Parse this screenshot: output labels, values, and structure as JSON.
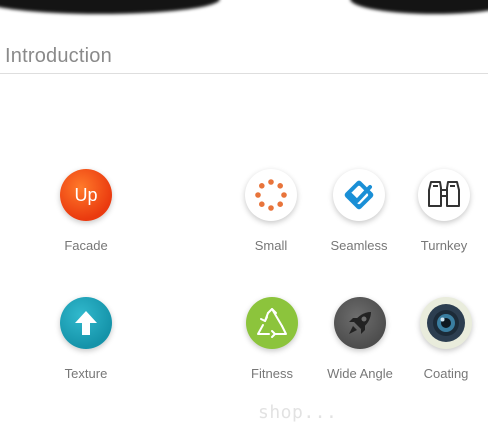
{
  "section": {
    "title": "Introduction"
  },
  "features": [
    {
      "label": "Facade",
      "badge": "Up",
      "icon": "up-badge-icon",
      "color": "#ef4e16"
    },
    {
      "label": "Small",
      "icon": "dotted-ring-icon",
      "color": "#e8743b"
    },
    {
      "label": "Seamless",
      "icon": "layered-check-icon",
      "color": "#1a8fd6"
    },
    {
      "label": "Turnkey",
      "icon": "binoculars-icon",
      "color": "#333333"
    },
    {
      "label": "Texture",
      "icon": "up-arrow-icon",
      "color": "#19a0b8"
    },
    {
      "label": "Fitness",
      "icon": "recycle-icon",
      "color": "#8cc43c"
    },
    {
      "label": "Wide Angle",
      "icon": "rocket-icon",
      "color": "#5c5c5c"
    },
    {
      "label": "Coating",
      "icon": "camera-lens-icon",
      "color": "#2c3e50"
    }
  ],
  "watermark": "shop..."
}
